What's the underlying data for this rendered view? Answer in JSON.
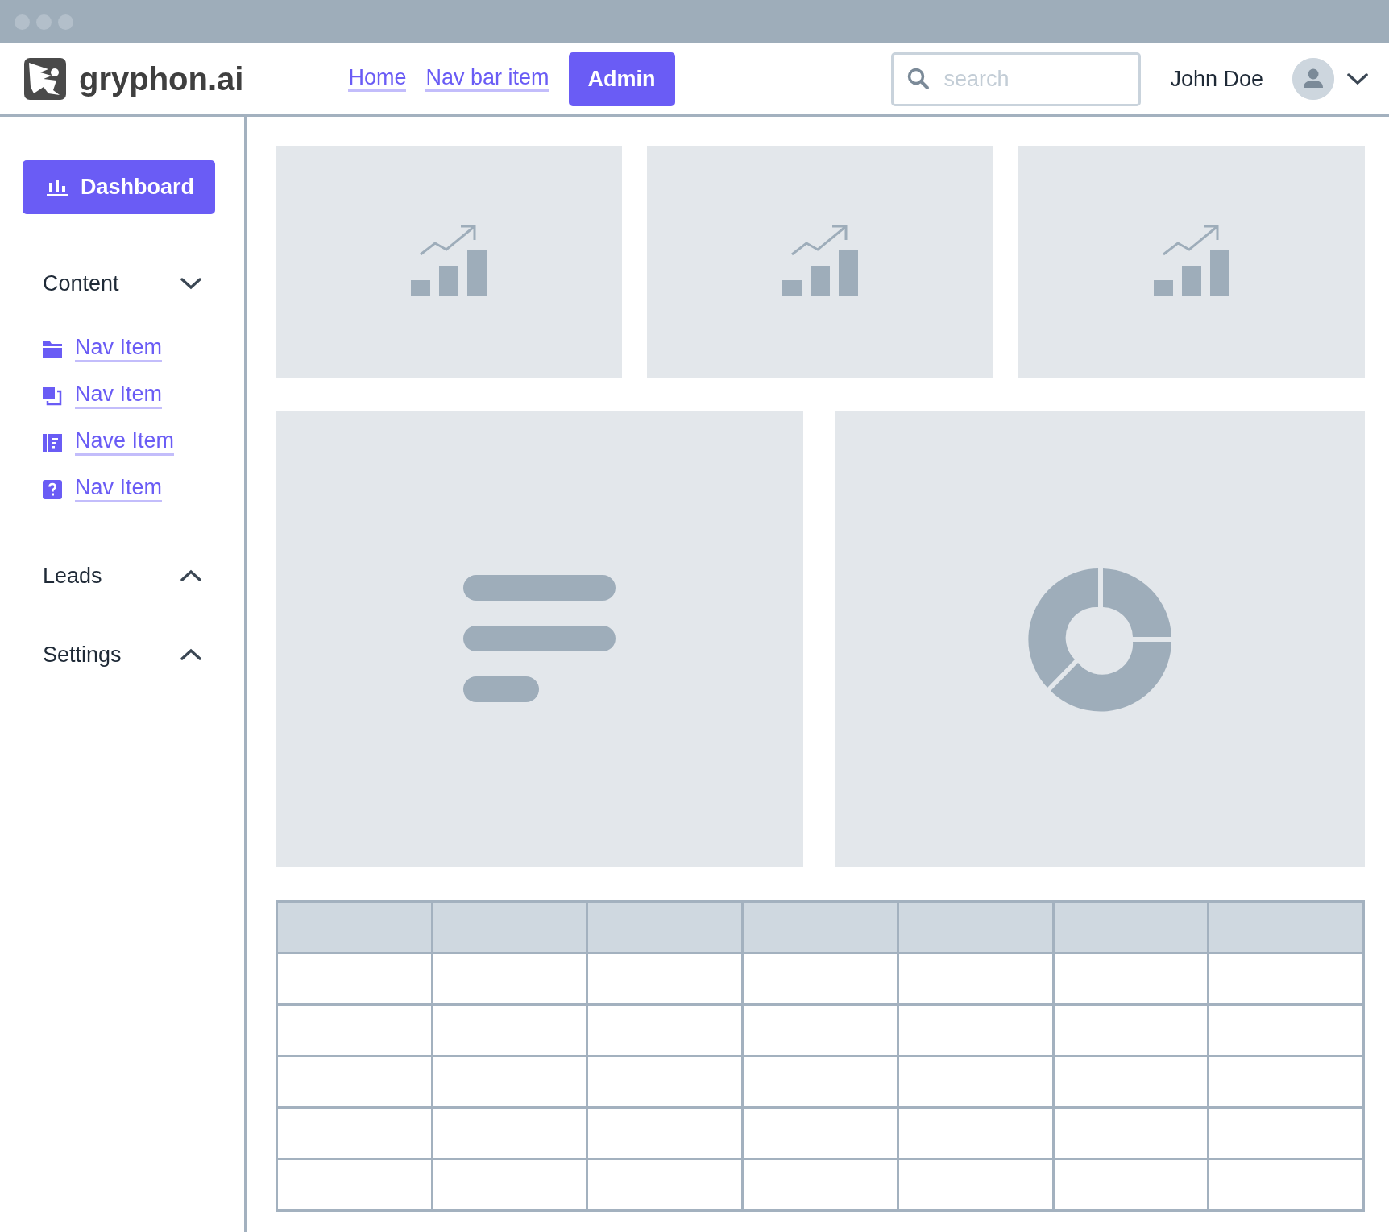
{
  "brand": {
    "name": "gryphon.ai"
  },
  "navbar": {
    "links": [
      {
        "label": "Home"
      },
      {
        "label": "Nav bar item"
      }
    ],
    "admin_button": "Admin",
    "search": {
      "placeholder": "search"
    },
    "user": {
      "name": "John Doe"
    }
  },
  "sidebar": {
    "primary_button": "Dashboard",
    "sections": [
      {
        "label": "Content",
        "expanded": true,
        "items": [
          {
            "label": "Nav Item"
          },
          {
            "label": "Nav Item"
          },
          {
            "label": "Nave Item"
          },
          {
            "label": "Nav Item"
          }
        ]
      },
      {
        "label": "Leads",
        "expanded": false
      },
      {
        "label": "Settings",
        "expanded": false
      }
    ]
  }
}
